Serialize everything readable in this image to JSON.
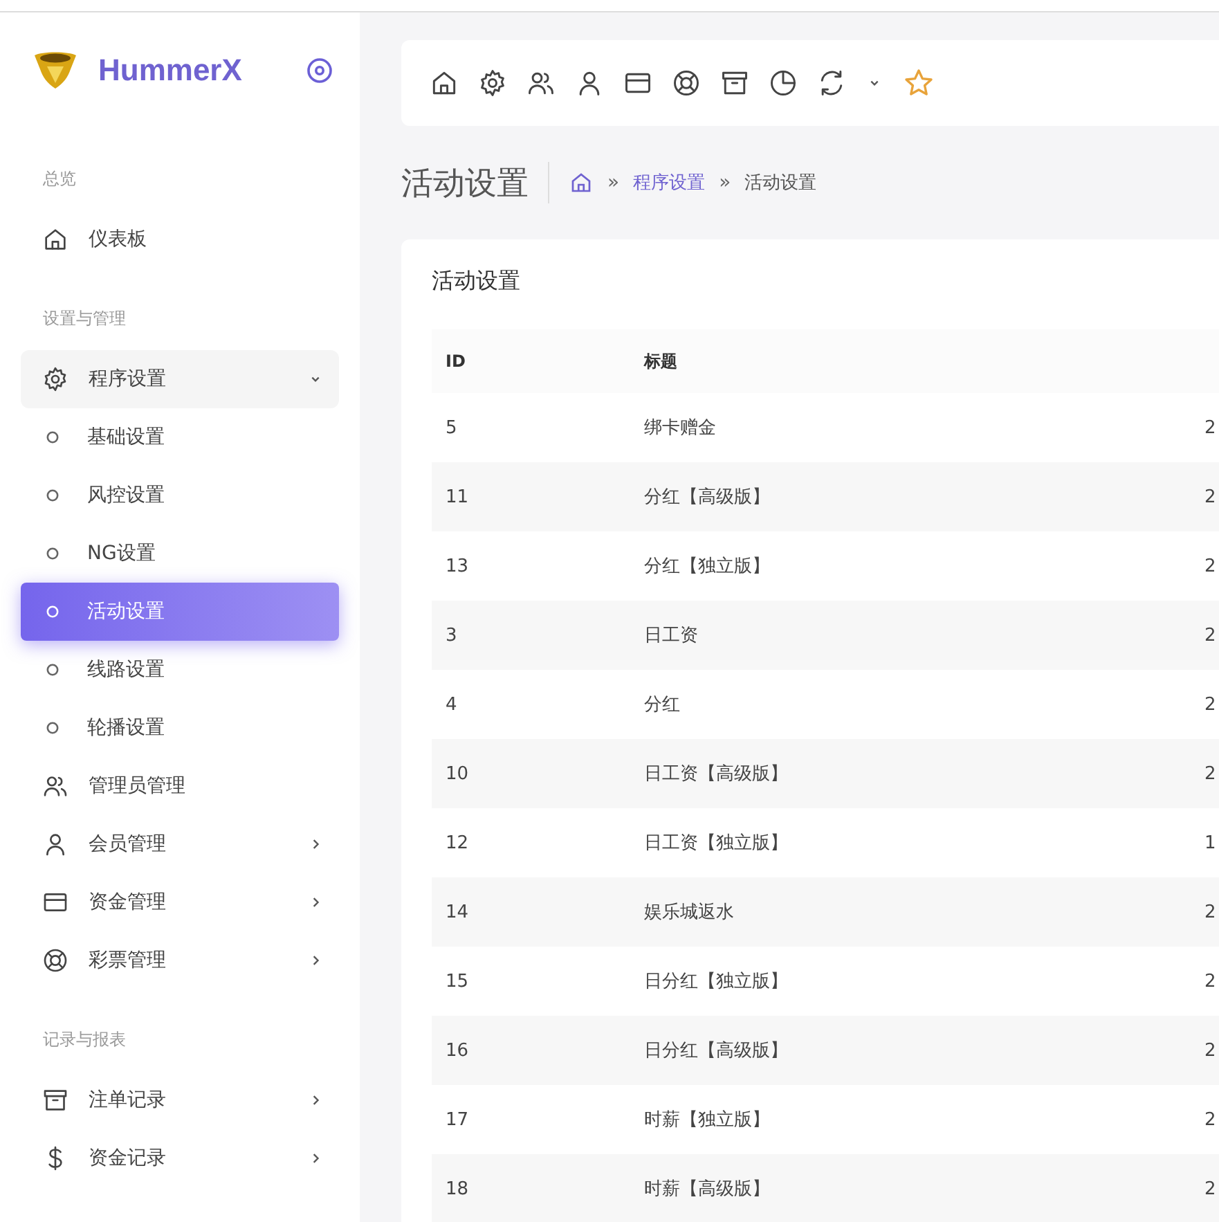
{
  "brand": {
    "name": "HummerX"
  },
  "sidebar": {
    "sections": [
      {
        "title": "总览",
        "items": [
          {
            "label": "仪表板"
          }
        ]
      },
      {
        "title": "设置与管理",
        "items": [
          {
            "label": "程序设置",
            "expanded": true,
            "children": [
              {
                "label": "基础设置",
                "selected": false
              },
              {
                "label": "风控设置",
                "selected": false
              },
              {
                "label": "NG设置",
                "selected": false
              },
              {
                "label": "活动设置",
                "selected": true
              },
              {
                "label": "线路设置",
                "selected": false
              },
              {
                "label": "轮播设置",
                "selected": false
              }
            ]
          },
          {
            "label": "管理员管理"
          },
          {
            "label": "会员管理",
            "expanded": false
          },
          {
            "label": "资金管理",
            "expanded": false
          },
          {
            "label": "彩票管理",
            "expanded": false
          }
        ]
      },
      {
        "title": "记录与报表",
        "items": [
          {
            "label": "注单记录",
            "expanded": false
          },
          {
            "label": "资金记录",
            "expanded": false
          }
        ]
      }
    ]
  },
  "page": {
    "title": "活动设置",
    "breadcrumb": [
      {
        "label": "»",
        "kind": "separator"
      },
      {
        "label": "程序设置",
        "kind": "link"
      },
      {
        "label": "»",
        "kind": "separator"
      },
      {
        "label": "活动设置",
        "kind": "current"
      }
    ]
  },
  "card": {
    "title": "活动设置"
  },
  "table": {
    "columns": [
      "ID",
      "标题"
    ],
    "rows": [
      {
        "id": "5",
        "title": "绑卡赠金",
        "column_3": "2"
      },
      {
        "id": "11",
        "title": "分红【高级版】",
        "column_3": "2"
      },
      {
        "id": "13",
        "title": "分红【独立版】",
        "column_3": "2"
      },
      {
        "id": "3",
        "title": "日工资",
        "column_3": "2"
      },
      {
        "id": "4",
        "title": "分红",
        "column_3": "2"
      },
      {
        "id": "10",
        "title": "日工资【高级版】",
        "column_3": "2"
      },
      {
        "id": "12",
        "title": "日工资【独立版】",
        "column_3": "1"
      },
      {
        "id": "14",
        "title": "娱乐城返水",
        "column_3": "2"
      },
      {
        "id": "15",
        "title": "日分红【独立版】",
        "column_3": "2"
      },
      {
        "id": "16",
        "title": "日分红【高级版】",
        "column_3": "2"
      },
      {
        "id": "17",
        "title": "时薪【独立版】",
        "column_3": "2"
      },
      {
        "id": "18",
        "title": "时薪【高级版】",
        "column_3": "2"
      }
    ]
  }
}
